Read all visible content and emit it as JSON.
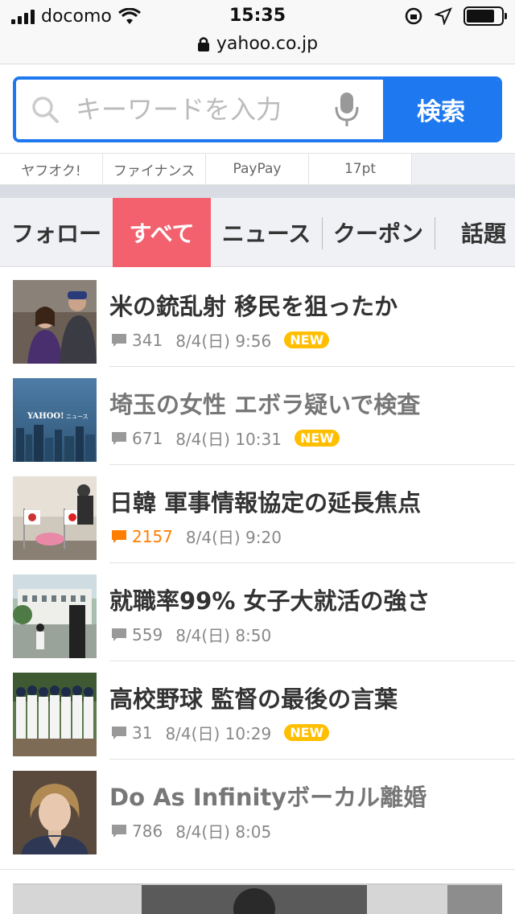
{
  "status_bar": {
    "carrier": "docomo",
    "time": "15:35"
  },
  "browser": {
    "url": "yahoo.co.jp"
  },
  "search": {
    "placeholder": "キーワードを入力",
    "button": "検索"
  },
  "quick_links": [
    "ヤフオク!",
    "ファイナンス",
    "PayPay",
    "17pt"
  ],
  "tabs": [
    {
      "label": "フォロー",
      "active": false
    },
    {
      "label": "すべて",
      "active": true
    },
    {
      "label": "ニュース",
      "active": false
    },
    {
      "label": "クーポン",
      "active": false
    },
    {
      "label": "話題",
      "active": false
    }
  ],
  "news": [
    {
      "title": "米の銃乱射 移民を狙ったか",
      "comments": "341",
      "date": "8/4(日) 9:56",
      "badge": "NEW",
      "read": false,
      "hot": false
    },
    {
      "title": "埼玉の女性 エボラ疑いで検査",
      "comments": "671",
      "date": "8/4(日) 10:31",
      "badge": "NEW",
      "read": true,
      "hot": false
    },
    {
      "title": "日韓 軍事情報協定の延長焦点",
      "comments": "2157",
      "date": "8/4(日) 9:20",
      "badge": "",
      "read": false,
      "hot": true
    },
    {
      "title": "就職率99% 女子大就活の強さ",
      "comments": "559",
      "date": "8/4(日) 8:50",
      "badge": "",
      "read": false,
      "hot": false
    },
    {
      "title": "高校野球 監督の最後の言葉",
      "comments": "31",
      "date": "8/4(日) 10:29",
      "badge": "NEW",
      "read": false,
      "hot": false
    },
    {
      "title": "Do As Infinityボーカル離婚",
      "comments": "786",
      "date": "8/4(日) 8:05",
      "badge": "",
      "read": true,
      "hot": false
    }
  ],
  "thumb_logo": {
    "brand": "YAHOO!",
    "sub": "ニュース"
  },
  "colors": {
    "accent": "#1e78f0",
    "active_tab": "#f2616d",
    "badge": "#ffbe00",
    "hot_comment": "#ff7d00"
  }
}
